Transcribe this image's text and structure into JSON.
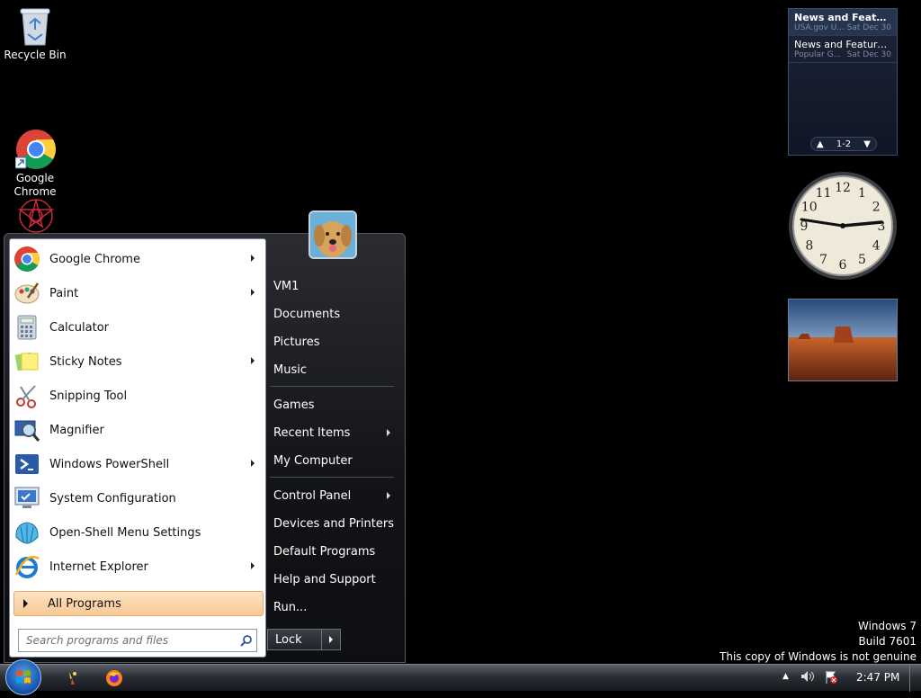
{
  "desktop": {
    "icons": [
      {
        "label": "Recycle Bin"
      },
      {
        "label": "Google\nChrome"
      }
    ]
  },
  "feed_gadget": {
    "items": [
      {
        "title": "News and Features f...",
        "source": "USA.gov U...",
        "date": "Sat Dec 30"
      },
      {
        "title": "News and Feature...",
        "source": "Popular G...",
        "date": "Sat Dec 30"
      }
    ],
    "page_indicator": "1-2"
  },
  "clock_gadget": {
    "numerals": [
      "12",
      "1",
      "2",
      "3",
      "4",
      "5",
      "6",
      "7",
      "8",
      "9",
      "10",
      "11"
    ]
  },
  "start_menu": {
    "programs": [
      {
        "label": "Google Chrome",
        "icon": "chrome-icon",
        "has_submenu": true
      },
      {
        "label": "Paint",
        "icon": "paint-icon",
        "has_submenu": true
      },
      {
        "label": "Calculator",
        "icon": "calculator-icon",
        "has_submenu": false
      },
      {
        "label": "Sticky Notes",
        "icon": "sticky-notes-icon",
        "has_submenu": true
      },
      {
        "label": "Snipping Tool",
        "icon": "scissors-icon",
        "has_submenu": false
      },
      {
        "label": "Magnifier",
        "icon": "magnifier-icon",
        "has_submenu": false
      },
      {
        "label": "Windows PowerShell",
        "icon": "powershell-icon",
        "has_submenu": true
      },
      {
        "label": "System Configuration",
        "icon": "system-config-icon",
        "has_submenu": false
      },
      {
        "label": "Open-Shell Menu Settings",
        "icon": "shell-icon",
        "has_submenu": false
      },
      {
        "label": "Internet Explorer",
        "icon": "ie-icon",
        "has_submenu": true
      }
    ],
    "all_programs_label": "All Programs",
    "search_placeholder": "Search programs and files",
    "right_items": [
      {
        "label": "VM1"
      },
      {
        "label": "Documents"
      },
      {
        "label": "Pictures"
      },
      {
        "label": "Music"
      },
      {
        "label": "Games"
      },
      {
        "label": "Recent Items",
        "has_submenu": true
      },
      {
        "label": "My Computer"
      },
      {
        "label": "Control Panel",
        "has_submenu": true
      },
      {
        "label": "Devices and Printers"
      },
      {
        "label": "Default Programs"
      },
      {
        "label": "Help and Support"
      },
      {
        "label": "Run..."
      }
    ],
    "lock_label": "Lock"
  },
  "watermark": {
    "line1": "Windows 7",
    "line2": "Build 7601",
    "line3": "This copy of Windows is not genuine"
  },
  "taskbar": {
    "clock": "2:47 PM"
  }
}
